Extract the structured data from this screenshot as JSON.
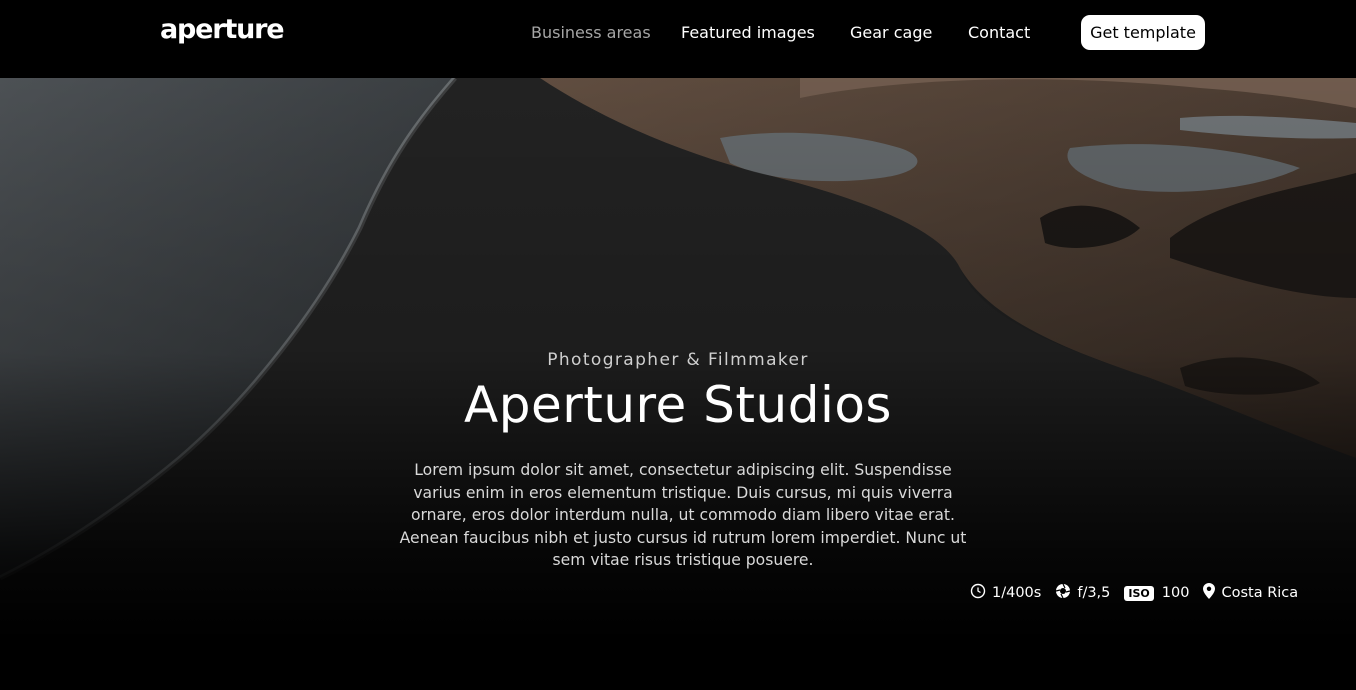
{
  "header": {
    "logo": "aperture",
    "nav": [
      {
        "label": "Business areas"
      },
      {
        "label": "Featured images"
      },
      {
        "label": "Gear cage"
      },
      {
        "label": "Contact"
      }
    ],
    "cta_label": "Get template"
  },
  "hero": {
    "eyebrow": "Photographer & Filmmaker",
    "title": "Aperture Studios",
    "description": "Lorem ipsum dolor sit amet, consectetur adipiscing elit. Suspendisse varius enim in eros elementum tristique. Duis cursus, mi quis viverra ornare, eros dolor interdum nulla, ut commodo diam libero vitae erat. Aenean faucibus nibh et justo cursus id rutrum lorem imperdiet. Nunc ut sem vitae risus tristique posuere.",
    "meta": {
      "shutter": "1/400s",
      "aperture": "f/3,5",
      "iso_label": "ISO",
      "iso_value": "100",
      "location": "Costa Rica"
    }
  },
  "icons": [
    "clock-icon",
    "aperture-icon",
    "iso-icon",
    "location-pin-icon"
  ],
  "colors": {
    "background": "#000000",
    "text": "#ffffff",
    "muted_nav": "#a6a6a6",
    "button_bg": "#ffffff"
  }
}
